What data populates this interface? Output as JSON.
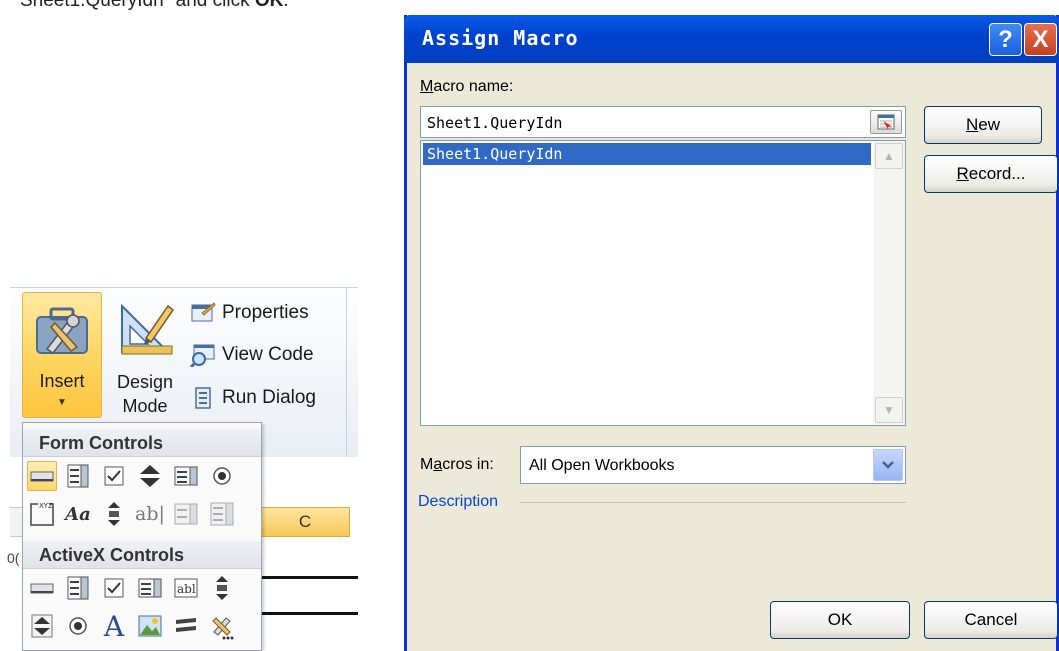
{
  "caption": {
    "prefix": "Sheet1.QueryIdn\" and click ",
    "bold": "OK",
    "suffix": "."
  },
  "ribbon": {
    "insert_label": "Insert",
    "design_label_1": "Design",
    "design_label_2": "Mode",
    "properties_label": "Properties",
    "view_code_label": "View Code",
    "run_dialog_label": "Run Dialog"
  },
  "sheet": {
    "column_c": "C",
    "cell_stub": "0("
  },
  "controls_panel": {
    "form_controls_header": "Form Controls",
    "activex_controls_header": "ActiveX Controls",
    "text_box_glyph": "ab|",
    "aa_glyph": "Aa",
    "label_glyph": "A"
  },
  "dialog": {
    "title": "Assign Macro",
    "help_glyph": "?",
    "close_glyph": "X",
    "macro_name_label_first": "M",
    "macro_name_label_rest": "acro name:",
    "macro_name_value": "Sheet1.QueryIdn",
    "macros": [
      "Sheet1.QueryIdn"
    ],
    "new_button_first": "N",
    "new_button_rest": "ew",
    "record_button_first": "R",
    "record_button_rest": "ecord...",
    "macros_in_label_first": "M",
    "macros_in_label_a": "a",
    "macros_in_label_rest": "cros in:",
    "macros_in_value": "All Open Workbooks",
    "description_label": "Description",
    "ok_label": "OK",
    "cancel_label": "Cancel"
  },
  "colors": {
    "title_bar": "#0043d0",
    "selection": "#316ac5",
    "insert_highlight": "#ffd867",
    "description_text": "#0046d5"
  }
}
